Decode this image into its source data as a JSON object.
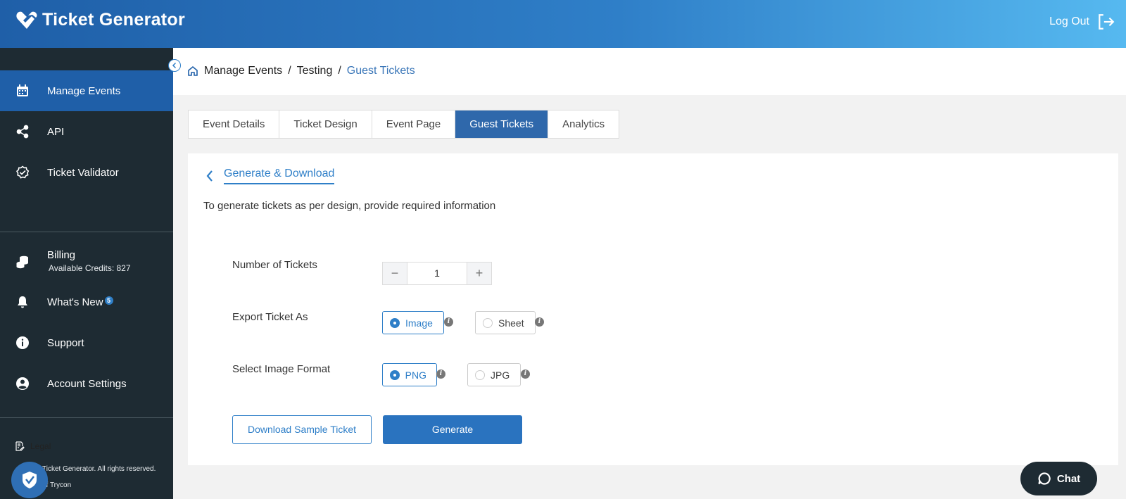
{
  "app": {
    "title": "Ticket Generator",
    "logout_label": "Log Out"
  },
  "sidebar": {
    "items": [
      {
        "label": "Manage Events",
        "icon": "calendar-icon",
        "active": true
      },
      {
        "label": "API",
        "icon": "share-icon"
      },
      {
        "label": "Ticket Validator",
        "icon": "verified-badge-icon"
      },
      {
        "label": "Billing",
        "icon": "coins-icon",
        "sub": "Available Credits: 827"
      },
      {
        "label": "What's New",
        "icon": "bell-icon",
        "badge": "5"
      },
      {
        "label": "Support",
        "icon": "info-icon"
      },
      {
        "label": "Account Settings",
        "icon": "user-circle-icon"
      }
    ],
    "legal_label": "Legal",
    "copyright_line1": "Ticket Generator. All rights reserved.",
    "copyright_line2": "of Trycon"
  },
  "breadcrumb": {
    "part1": "Manage Events",
    "sep1": "/",
    "part2": "Testing",
    "sep2": "/",
    "current": "Guest Tickets"
  },
  "tabs": [
    {
      "label": "Event Details"
    },
    {
      "label": "Ticket Design"
    },
    {
      "label": "Event Page"
    },
    {
      "label": "Guest Tickets",
      "active": true
    },
    {
      "label": "Analytics"
    }
  ],
  "card": {
    "title": "Generate & Download",
    "description": "To generate tickets as per design, provide required information"
  },
  "form": {
    "tickets_label": "Number of Tickets",
    "tickets_value": "1",
    "minus": "−",
    "plus": "+",
    "export_label": "Export Ticket As",
    "export_options": [
      "Image",
      "Sheet"
    ],
    "export_selected": "Image",
    "format_label": "Select Image Format",
    "format_options": [
      "PNG",
      "JPG"
    ],
    "format_selected": "PNG",
    "info_glyph": "i"
  },
  "actions": {
    "download_sample": "Download Sample Ticket",
    "generate": "Generate"
  },
  "chat": {
    "label": "Chat"
  },
  "colors": {
    "header_start": "#1f5fa8",
    "header_end": "#56b9f0",
    "sidebar": "#1e2b33",
    "accent": "#2f7fc8",
    "tab_active": "#2f68ab"
  }
}
